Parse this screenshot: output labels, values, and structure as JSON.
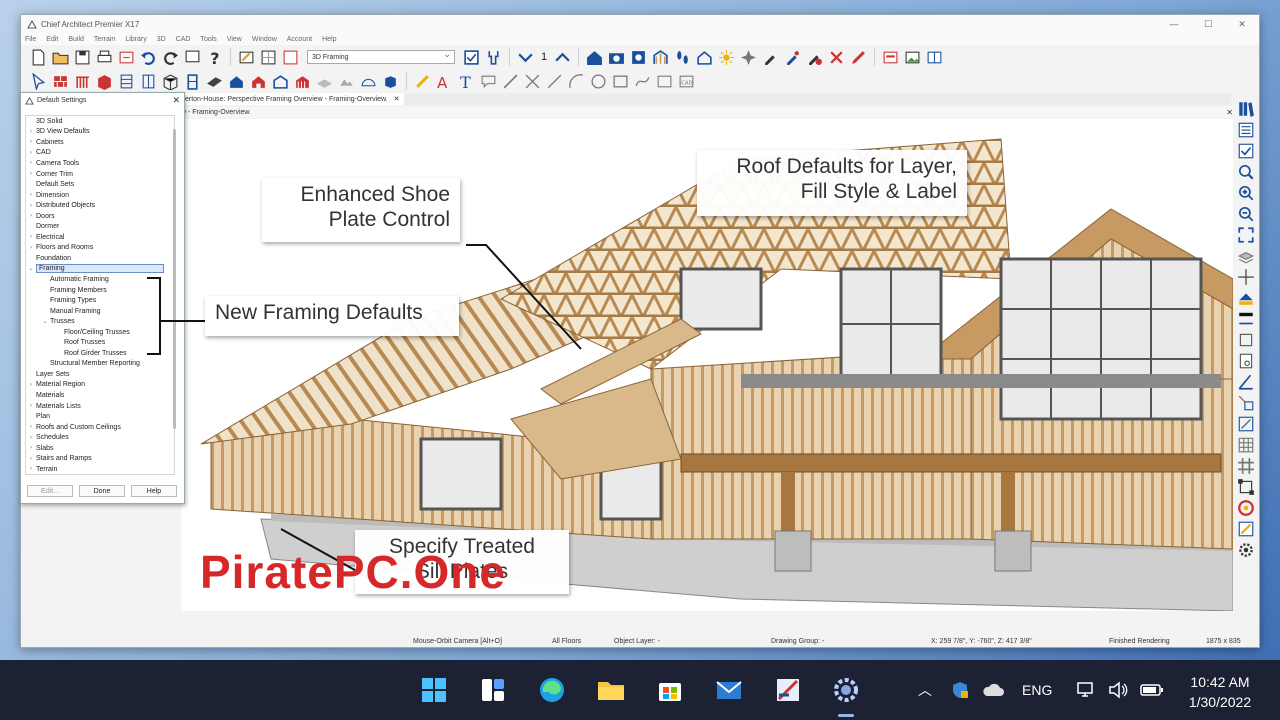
{
  "window": {
    "title": "Chief Architect Premier X17",
    "menu": [
      "File",
      "Edit",
      "Build",
      "Terrain",
      "Library",
      "3D",
      "CAD",
      "Tools",
      "View",
      "Window",
      "Account",
      "Help"
    ],
    "view_combo": "3D Framing",
    "floor_number": "1"
  },
  "document": {
    "tab_title": "erton-House: Perspective Framing Overview - Framing-Overview.",
    "tab_close": "✕",
    "sub_title": "w - Framing-Overview."
  },
  "panel": {
    "title": "Default Settings",
    "close": "✕",
    "tree": [
      {
        "label": "3D Solid",
        "depth": 0,
        "caret": ""
      },
      {
        "label": "3D View Defaults",
        "depth": 0,
        "caret": ">"
      },
      {
        "label": "Cabinets",
        "depth": 0,
        "caret": ">"
      },
      {
        "label": "CAD",
        "depth": 0,
        "caret": ">"
      },
      {
        "label": "Camera Tools",
        "depth": 0,
        "caret": ">"
      },
      {
        "label": "Corner Trim",
        "depth": 0,
        "caret": ">"
      },
      {
        "label": "Default Sets",
        "depth": 0,
        "caret": ""
      },
      {
        "label": "Dimension",
        "depth": 0,
        "caret": ">"
      },
      {
        "label": "Distributed Objects",
        "depth": 0,
        "caret": ">"
      },
      {
        "label": "Doors",
        "depth": 0,
        "caret": ">"
      },
      {
        "label": "Dormer",
        "depth": 0,
        "caret": ""
      },
      {
        "label": "Electrical",
        "depth": 0,
        "caret": ">"
      },
      {
        "label": "Floors and Rooms",
        "depth": 0,
        "caret": ">"
      },
      {
        "label": "Foundation",
        "depth": 0,
        "caret": ""
      },
      {
        "label": "Framing",
        "depth": 0,
        "caret": "v",
        "selected": true
      },
      {
        "label": "Automatic Framing",
        "depth": 1,
        "caret": ""
      },
      {
        "label": "Framing Members",
        "depth": 1,
        "caret": ""
      },
      {
        "label": "Framing Types",
        "depth": 1,
        "caret": ""
      },
      {
        "label": "Manual Framing",
        "depth": 1,
        "caret": ""
      },
      {
        "label": "Trusses",
        "depth": 1,
        "caret": "v"
      },
      {
        "label": "Floor/Ceiling Trusses",
        "depth": 2,
        "caret": ""
      },
      {
        "label": "Roof Trusses",
        "depth": 2,
        "caret": ""
      },
      {
        "label": "Roof Girder Trusses",
        "depth": 2,
        "caret": ""
      },
      {
        "label": "Structural Member Reporting",
        "depth": 1,
        "caret": ""
      },
      {
        "label": "Layer Sets",
        "depth": 0,
        "caret": ""
      },
      {
        "label": "Material Region",
        "depth": 0,
        "caret": ">"
      },
      {
        "label": "Materials",
        "depth": 0,
        "caret": ""
      },
      {
        "label": "Materials Lists",
        "depth": 0,
        "caret": ">"
      },
      {
        "label": "Plan",
        "depth": 0,
        "caret": ""
      },
      {
        "label": "Roofs and Custom Ceilings",
        "depth": 0,
        "caret": ">"
      },
      {
        "label": "Schedules",
        "depth": 0,
        "caret": ">"
      },
      {
        "label": "Slabs",
        "depth": 0,
        "caret": ">"
      },
      {
        "label": "Stairs and Ramps",
        "depth": 0,
        "caret": ">"
      },
      {
        "label": "Terrain",
        "depth": 0,
        "caret": ">"
      }
    ],
    "buttons": {
      "edit": "Edit...",
      "done": "Done",
      "help": "Help"
    }
  },
  "callouts": {
    "shoe_line1": "Enhanced Shoe",
    "shoe_line2": "Plate Control",
    "roof_line1": "Roof Defaults for Layer,",
    "roof_line2": "Fill Style & Label",
    "framing": "New Framing Defaults",
    "sill_line1": "Specify Treated",
    "sill_line2": "Sill Plates"
  },
  "watermark": "PiratePC.One",
  "status": {
    "mode": "Mouse-Orbit Camera [Alt+O]",
    "floors": "All Floors",
    "layer": "Object Layer: -",
    "group": "Drawing Group: -",
    "coords": "X: 259 7/8\", Y: -760\", Z: 417 3/8\"",
    "render": "Finished Rendering",
    "size": "1875 x 835"
  },
  "taskbar": {
    "language": "ENG",
    "time": "10:42 AM",
    "date": "1/30/2022"
  },
  "colors": {
    "wood": "#c79a63",
    "wood_dark": "#8a6336",
    "accent": "#d62828",
    "taskbar": "#1c2233"
  }
}
